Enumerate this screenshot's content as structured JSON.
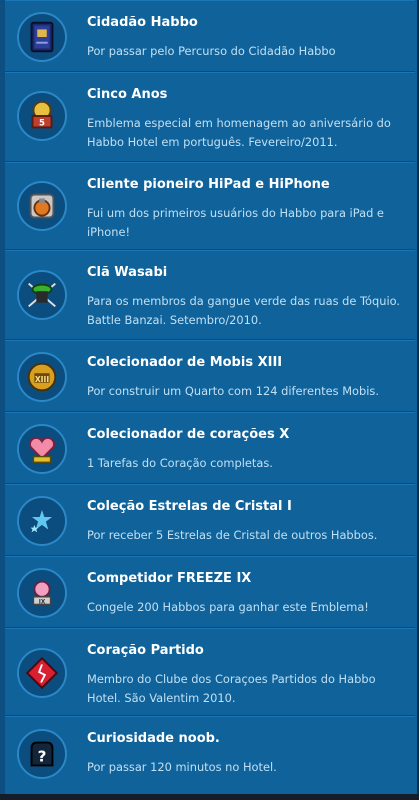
{
  "badges": [
    {
      "title": "Cidadão Habbo",
      "description": "Por passar pelo Percurso do Cidadão Habbo",
      "icon": "citizen-passport-badge-icon"
    },
    {
      "title": "Cinco Anos",
      "description": "Emblema especial em homenagem ao aniversário do Habbo Hotel em português. Fevereiro/2011.",
      "icon": "five-years-cake-badge-icon"
    },
    {
      "title": "Cliente pioneiro HiPad e HiPhone",
      "description": "Fui um dos primeiros usuários do Habbo para iPad e iPhone!",
      "icon": "pioneer-hipad-badge-icon"
    },
    {
      "title": "Clã Wasabi",
      "description": "Para os membros da gangue verde das ruas de Tóquio. Battle Banzai. Setembro/2010.",
      "icon": "wasabi-clan-badge-icon"
    },
    {
      "title": "Colecionador de Mobis XIII",
      "description": "Por construir um Quarto com 124 diferentes Mobis.",
      "icon": "furni-collector-badge-icon"
    },
    {
      "title": "Colecionador de corações X",
      "description": "1 Tarefas do Coração completas.",
      "icon": "heart-collector-badge-icon"
    },
    {
      "title": "Coleção Estrelas de Cristal I",
      "description": "Por receber 5 Estrelas de Cristal de outros Habbos.",
      "icon": "crystal-stars-badge-icon"
    },
    {
      "title": "Competidor FREEZE IX",
      "description": "Congele 200 Habbos para ganhar este Emblema!",
      "icon": "freeze-competitor-badge-icon"
    },
    {
      "title": "Coração Partido",
      "description": "Membro do Clube dos Coraçoes Partidos do Habbo Hotel. São Valentim 2010.",
      "icon": "broken-heart-badge-icon"
    },
    {
      "title": "Curiosidade noob.",
      "description": "Por passar 120 minutos no Hotel.",
      "icon": "noob-curiosity-badge-icon"
    }
  ]
}
